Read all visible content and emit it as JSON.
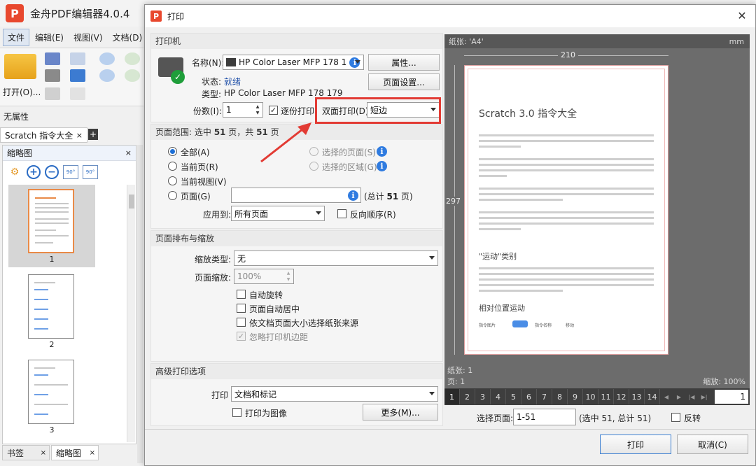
{
  "app": {
    "title": "金舟PDF编辑器4.0.4",
    "logo": "P",
    "menu": [
      "文件",
      "编辑(E)",
      "视图(V)",
      "文档(D)"
    ],
    "open_label": "打开(O)...",
    "no_props": "无属性",
    "doc_tab": "Scratch 指令大全",
    "add_tab": "+",
    "thumb_title": "缩略图",
    "thumbs": [
      "1",
      "2",
      "3"
    ],
    "bottom_tabs": [
      "书签",
      "缩略图"
    ],
    "close_glyph": "×"
  },
  "dialog": {
    "title": "打印",
    "icon": "P",
    "close": "✕",
    "printer": {
      "section": "打印机",
      "name_label": "名称(N):",
      "name_value": "HP Color Laser MFP 178 1",
      "props_button": "属性...",
      "status_label": "状态:",
      "status_value": "就绪",
      "type_label": "类型:",
      "type_value": "HP Color Laser MFP 178 179",
      "page_setup_button": "页面设置...",
      "copies_label": "份数(I):",
      "copies_value": "1",
      "collate_label": "逐份打印",
      "collate_checked": true,
      "duplex_label": "双面打印(D)",
      "duplex_value": "短边"
    },
    "range": {
      "head_prefix": "页面范围: 选中",
      "head_selected": "51",
      "head_mid": "页，共",
      "head_total": "51",
      "head_suffix": "页",
      "all": "全部(A)",
      "current_page": "当前页(R)",
      "current_view": "当前视图(V)",
      "pages": "页面(G)",
      "selected_pages": "选择的页面(S)",
      "selected_area": "选择的区域(G)",
      "total_prefix": "(总计",
      "total_num": "51",
      "total_suffix": "页)",
      "apply_label": "应用到:",
      "apply_value": "所有页面",
      "reverse_label": "反向顺序(R)"
    },
    "layout": {
      "section": "页面排布与缩放",
      "scale_type_label": "缩放类型:",
      "scale_type_value": "无",
      "scale_label": "页面缩放:",
      "scale_value": "100%",
      "auto_rotate": "自动旋转",
      "auto_center": "页面自动居中",
      "paper_source": "依文档页面大小选择纸张来源",
      "ignore_margins": "忽略打印机边距"
    },
    "advanced": {
      "section": "高级打印选项",
      "print_label": "打印",
      "print_value": "文档和标记",
      "as_image": "打印为图像",
      "more_button": "更多(M)..."
    },
    "preview": {
      "paper_head": "纸张: 'A4'",
      "unit": "mm",
      "width": "210",
      "height": "297",
      "doc_title": "Scratch 3.0 指令大全",
      "sub1": "\"运动\"类别",
      "sub2": "相对位置运动",
      "small1": "指令图片",
      "small2": "指令名称",
      "small3": "移动",
      "foot_paper": "纸张: 1",
      "foot_page": "页: 1",
      "foot_zoom": "缩放: 100%",
      "pages": [
        "1",
        "2",
        "3",
        "4",
        "5",
        "6",
        "7",
        "8",
        "9",
        "10",
        "11",
        "12",
        "13",
        "14"
      ],
      "current_page": "1"
    },
    "select_pages_label": "选择页面:",
    "select_pages_value": "1-51",
    "select_summary": "(选中 51, 总计 51)",
    "invert_label": "反转",
    "print_button": "打印",
    "cancel_button": "取消(C)"
  },
  "colors": {
    "highlight": "#e23b34",
    "accent": "#1d6fd6",
    "status_green": "#1f9e3a"
  }
}
